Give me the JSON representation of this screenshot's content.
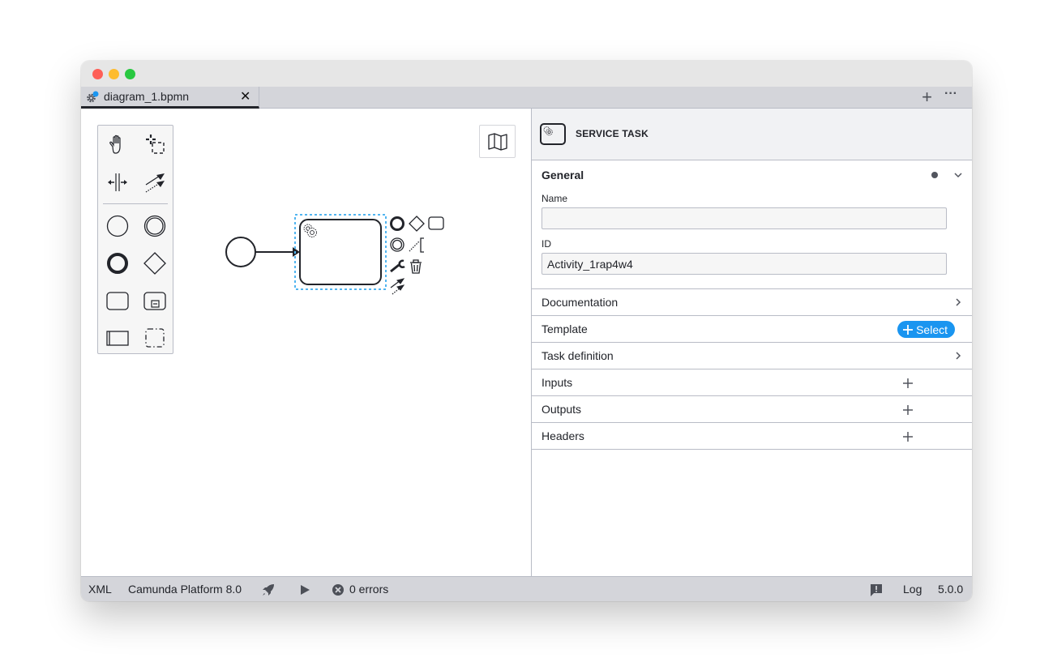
{
  "window": {
    "traffic_lights": {
      "close": "#fe5f57",
      "minimize": "#febc2e",
      "maximize": "#28c840"
    }
  },
  "tabs": {
    "items": [
      {
        "label": "diagram_1.bpmn",
        "icon": "gear-modified-icon",
        "active": true,
        "close_glyph": "✕"
      }
    ],
    "add_glyph": "+",
    "more_glyph": "•••"
  },
  "palette": {
    "tools": [
      {
        "name": "hand-tool",
        "icon": "hand-icon"
      },
      {
        "name": "lasso-tool",
        "icon": "lasso-icon"
      },
      {
        "name": "space-tool",
        "icon": "space-tool-icon"
      },
      {
        "name": "global-connect-tool",
        "icon": "connect-icon"
      },
      {
        "name": "create-start-event",
        "icon": "start-event-icon"
      },
      {
        "name": "create-intermediate-event",
        "icon": "intermediate-event-icon"
      },
      {
        "name": "create-end-event",
        "icon": "end-event-icon"
      },
      {
        "name": "create-gateway",
        "icon": "gateway-icon"
      },
      {
        "name": "create-task",
        "icon": "task-icon"
      },
      {
        "name": "create-subprocess",
        "icon": "subprocess-icon"
      },
      {
        "name": "create-pool",
        "icon": "pool-icon"
      },
      {
        "name": "create-group",
        "icon": "group-icon"
      }
    ]
  },
  "diagram": {
    "elements": [
      {
        "type": "start-event"
      },
      {
        "type": "sequence-flow"
      },
      {
        "type": "service-task",
        "selected": true,
        "id": "Activity_1rap4w4"
      }
    ],
    "context_pad": [
      "append-end-event",
      "append-gateway",
      "append-task",
      "append-intermediate-event",
      "append-text-annotation",
      "replace",
      "delete",
      "connect"
    ],
    "selection_color": "#52b5f0"
  },
  "properties": {
    "header": {
      "title": "SERVICE TASK"
    },
    "general": {
      "title": "General",
      "name_label": "Name",
      "name_value": "",
      "id_label": "ID",
      "id_value": "Activity_1rap4w4"
    },
    "groups": [
      {
        "title": "Documentation",
        "action": "chevron"
      },
      {
        "title": "Template",
        "action": "select",
        "button_label": "Select"
      },
      {
        "title": "Task definition",
        "action": "chevron"
      },
      {
        "title": "Inputs",
        "action": "add"
      },
      {
        "title": "Outputs",
        "action": "add"
      },
      {
        "title": "Headers",
        "action": "add"
      }
    ],
    "accent": "#1a95f0"
  },
  "statusbar": {
    "xml": "XML",
    "platform": "Camunda Platform 8.0",
    "errors": "0 errors",
    "log": "Log",
    "version": "5.0.0"
  }
}
